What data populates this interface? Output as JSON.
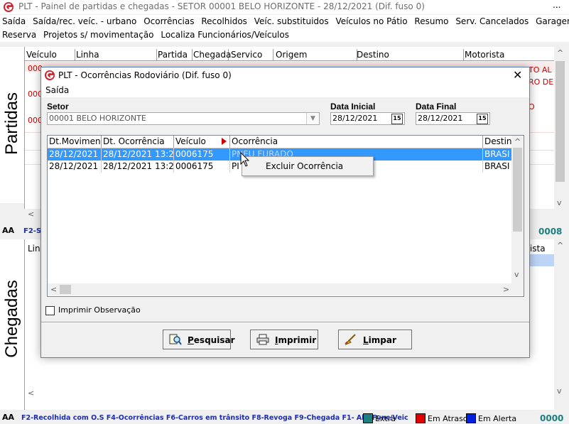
{
  "app": {
    "title": "PLT - Painel de partidas e chegadas  -  SETOR 00001 BELO HORIZONTE  -  28/12/2021 (Dif. fuso 0)",
    "more": "..."
  },
  "menu1": [
    "Saída",
    "Saída/rec. veíc. - urbano",
    "Ocorrências",
    "Recolhidos",
    "Veíc. substituidos",
    "Veículos no Pátio",
    "Resumo",
    "Serv. Cancelados",
    "Garagem"
  ],
  "menu2": [
    "Reserva",
    "Projetos s/ movimentação",
    "Localiza Funcionários/Veículos"
  ],
  "partidas": {
    "label": "Partidas",
    "columns": [
      "Veículo",
      "Linha",
      "Partida",
      "Chegada",
      "Servico",
      "Origem",
      "Destino",
      "Motorista"
    ],
    "row_fragments": [
      "000",
      "000",
      "000"
    ],
    "right_fragments": [
      "TO AL",
      "RO DE",
      "O"
    ],
    "status_left": "F2-Sa",
    "count": "0008",
    "aa": "A"
  },
  "chegadas": {
    "label": "Chegadas",
    "col_linha": "Linh",
    "col_motorista": "rista",
    "status": "F2-Recolhida com O.S  F4-Ocorrências  F6-Carros em trânsito  F8-Revoga  F9-Chegada  F1- Alt. Func/Veic",
    "legend": [
      {
        "label": "Extra",
        "color": "#1d7f7f"
      },
      {
        "label": "Em Atraso",
        "color": "#e00000"
      },
      {
        "label": "Em Alerta",
        "color": "#0020e0"
      }
    ],
    "count": "0000"
  },
  "dialog": {
    "title": "PLT - Ocorrências Rodoviário (Dif. fuso 0)",
    "menu": "Saída",
    "setor_label": "Setor",
    "setor_value": "00001 BELO HORIZONTE",
    "data_inicial_label": "Data Inicial",
    "data_inicial_value": "28/12/2021",
    "data_final_label": "Data Final",
    "data_final_value": "28/12/2021",
    "cal_icon_text": "15",
    "grid_columns": [
      "Dt.Movimento",
      "Dt. Ocorrência",
      "Veículo",
      "Ocorrência",
      "Destino"
    ],
    "rows": [
      {
        "dt_mov": "28/12/2021",
        "dt_oc": "28/12/2021 13:2...",
        "veiculo": "0006175",
        "ocorrencia": "PNEU FURADO",
        "destino": "BRASI"
      },
      {
        "dt_mov": "28/12/2021",
        "dt_oc": "28/12/2021 13:2...",
        "veiculo": "0006175",
        "ocorrencia": "PI",
        "destino": "BRASI"
      }
    ],
    "context_menu": "Excluir Ocorrência",
    "imprimir_obs": "Imprimir Observação",
    "buttons": {
      "pesquisar_first": "P",
      "pesquisar_rest": "esquisar",
      "imprimir_first": "I",
      "imprimir_rest": "mprimir",
      "limpar_first": "L",
      "limpar_rest": "impar"
    }
  }
}
